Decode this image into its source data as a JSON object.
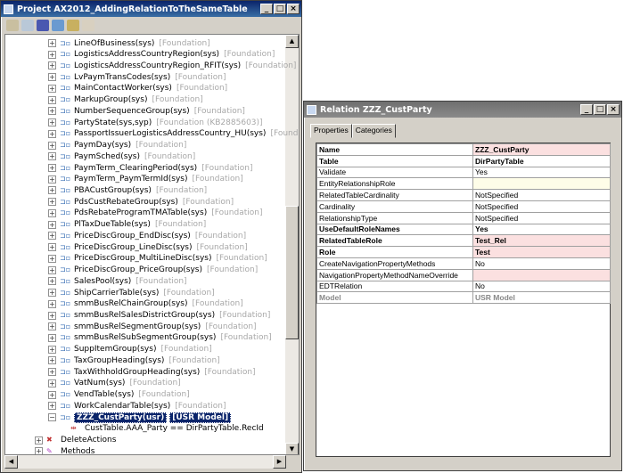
{
  "project_window": {
    "title": "Project AX2012_AddingRelationToTheSameTable",
    "toolbar": [
      "open-icon",
      "properties-icon",
      "compile-icon",
      "sync-icon",
      "filter-icon",
      "export-icon"
    ],
    "tree_items": [
      {
        "label": "LineOfBusiness(sys)",
        "layer": "[Foundation]"
      },
      {
        "label": "LogisticsAddressCountryRegion(sys)",
        "layer": "[Foundation]"
      },
      {
        "label": "LogisticsAddressCountryRegion_RFIT(sys)",
        "layer": "[Foundation]"
      },
      {
        "label": "LvPaymTransCodes(sys)",
        "layer": "[Foundation]"
      },
      {
        "label": "MainContactWorker(sys)",
        "layer": "[Foundation]"
      },
      {
        "label": "MarkupGroup(sys)",
        "layer": "[Foundation]"
      },
      {
        "label": "NumberSequenceGroup(sys)",
        "layer": "[Foundation]"
      },
      {
        "label": "PartyState(sys,syp)",
        "layer": "[Foundation (KB2885603)]"
      },
      {
        "label": "PassportIssuerLogisticsAddressCountry_HU(sys)",
        "layer": "[Foundation]"
      },
      {
        "label": "PaymDay(sys)",
        "layer": "[Foundation]"
      },
      {
        "label": "PaymSched(sys)",
        "layer": "[Foundation]"
      },
      {
        "label": "PaymTerm_ClearingPeriod(sys)",
        "layer": "[Foundation]"
      },
      {
        "label": "PaymTerm_PaymTermId(sys)",
        "layer": "[Foundation]"
      },
      {
        "label": "PBACustGroup(sys)",
        "layer": "[Foundation]"
      },
      {
        "label": "PdsCustRebateGroup(sys)",
        "layer": "[Foundation]"
      },
      {
        "label": "PdsRebateProgramTMATable(sys)",
        "layer": "[Foundation]"
      },
      {
        "label": "PlTaxDueTable(sys)",
        "layer": "[Foundation]"
      },
      {
        "label": "PriceDiscGroup_EndDisc(sys)",
        "layer": "[Foundation]"
      },
      {
        "label": "PriceDiscGroup_LineDisc(sys)",
        "layer": "[Foundation]"
      },
      {
        "label": "PriceDiscGroup_MultiLineDisc(sys)",
        "layer": "[Foundation]"
      },
      {
        "label": "PriceDiscGroup_PriceGroup(sys)",
        "layer": "[Foundation]"
      },
      {
        "label": "SalesPool(sys)",
        "layer": "[Foundation]"
      },
      {
        "label": "ShipCarrierTable(sys)",
        "layer": "[Foundation]"
      },
      {
        "label": "smmBusRelChainGroup(sys)",
        "layer": "[Foundation]"
      },
      {
        "label": "smmBusRelSalesDistrictGroup(sys)",
        "layer": "[Foundation]"
      },
      {
        "label": "smmBusRelSegmentGroup(sys)",
        "layer": "[Foundation]"
      },
      {
        "label": "smmBusRelSubSegmentGroup(sys)",
        "layer": "[Foundation]"
      },
      {
        "label": "SuppItemGroup(sys)",
        "layer": "[Foundation]"
      },
      {
        "label": "TaxGroupHeading(sys)",
        "layer": "[Foundation]"
      },
      {
        "label": "TaxWithholdGroupHeading(sys)",
        "layer": "[Foundation]"
      },
      {
        "label": "VatNum(sys)",
        "layer": "[Foundation]"
      },
      {
        "label": "VendTable(sys)",
        "layer": "[Foundation]"
      },
      {
        "label": "WorkCalendarTable(sys)",
        "layer": "[Foundation]"
      }
    ],
    "selected_item": {
      "label": "ZZZ_CustParty(usr)",
      "layer": "[USR Model]"
    },
    "relation_field": "CustTable.AAA_Party == DirPartyTable.RecId",
    "delete_actions": "DeleteActions",
    "methods": "Methods"
  },
  "property_window": {
    "title": "Relation ZZZ_CustParty",
    "tabs": [
      "Properties",
      "Categories"
    ],
    "properties": [
      {
        "name": "Name",
        "value": "ZZZ_CustParty",
        "style": "bold pink"
      },
      {
        "name": "Table",
        "value": "DirPartyTable",
        "style": "bold"
      },
      {
        "name": "Validate",
        "value": "Yes",
        "style": ""
      },
      {
        "name": "EntityRelationshipRole",
        "value": "",
        "style": "yel"
      },
      {
        "name": "RelatedTableCardinality",
        "value": "NotSpecified",
        "style": ""
      },
      {
        "name": "Cardinality",
        "value": "NotSpecified",
        "style": ""
      },
      {
        "name": "RelationshipType",
        "value": "NotSpecified",
        "style": ""
      },
      {
        "name": "UseDefaultRoleNames",
        "value": "Yes",
        "style": "bold"
      },
      {
        "name": "RelatedTableRole",
        "value": "Test_Rel",
        "style": "bold pink"
      },
      {
        "name": "Role",
        "value": "Test",
        "style": "bold pink"
      },
      {
        "name": "CreateNavigationPropertyMethods",
        "value": "No",
        "style": ""
      },
      {
        "name": "NavigationPropertyMethodNameOverride",
        "value": "",
        "style": "pink"
      },
      {
        "name": "EDTRelation",
        "value": "No",
        "style": ""
      },
      {
        "name": "Model",
        "value": "USR Model",
        "style": "gray"
      }
    ]
  }
}
